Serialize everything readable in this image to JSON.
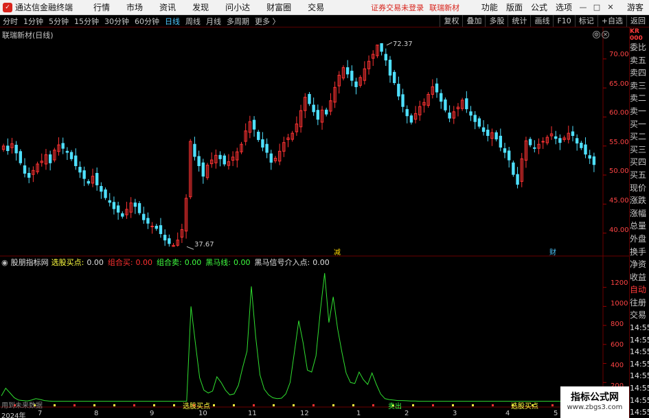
{
  "titlebar": {
    "app_title": "通达信金融终端",
    "menu": [
      "行情",
      "市场",
      "资讯",
      "发现",
      "问小达",
      "财富圈",
      "交易"
    ],
    "alert": "证券交易未登录",
    "stock": "联瑞新材",
    "right_menu": [
      "功能",
      "版面",
      "公式",
      "选项"
    ],
    "guest": "游客"
  },
  "toolbar": {
    "periods": [
      "分时",
      "1分钟",
      "5分钟",
      "15分钟",
      "30分钟",
      "60分钟",
      "日线",
      "周线",
      "月线",
      "多周期",
      "更多 〉"
    ],
    "active_period": "日线",
    "right_buttons": [
      "复权",
      "叠加",
      "多股",
      "统计",
      "画线",
      "F10",
      "标记",
      "+自选",
      "返回"
    ]
  },
  "chart": {
    "title": "联瑞新材(日线)",
    "high_label": "72.37",
    "low_label": "37.67",
    "marker_jian": "减",
    "marker_cai": "财",
    "price_ticks": [
      "70.00",
      "65.00",
      "60.00",
      "55.00",
      "50.00",
      "45.00",
      "40.00"
    ]
  },
  "indicator": {
    "name": "股朋指标网",
    "items": [
      {
        "label": "选股买点:",
        "value": "0.00",
        "color": "#ffff40"
      },
      {
        "label": "组合买:",
        "value": "0.00",
        "color": "#ff3030"
      },
      {
        "label": "组合卖:",
        "value": "0.00",
        "color": "#40ff40"
      },
      {
        "label": "黑马线:",
        "value": "0.00",
        "color": "#40ff40"
      },
      {
        "label": "黑马信号介入点:",
        "value": "0.00",
        "color": "#e0e0e0"
      }
    ],
    "ticks": [
      "1200",
      "1000",
      "800",
      "600",
      "400",
      "200"
    ],
    "buy_point_label": "选股买点",
    "sell_label": "卖出",
    "no_data": "用到未来数据"
  },
  "x_axis": {
    "year_label": "2024年",
    "months": [
      "7",
      "8",
      "9",
      "10",
      "11",
      "12",
      "1",
      "2",
      "3",
      "4",
      "5"
    ]
  },
  "sidepanel": {
    "header": "KR\n000",
    "items": [
      "委比",
      "卖五",
      "卖四",
      "卖三",
      "卖二",
      "卖一",
      "买一",
      "买二",
      "买三",
      "买四",
      "买五",
      "现价",
      "涨跌",
      "涨幅",
      "总量",
      "外盘",
      "换手",
      "净资",
      "收益",
      "自动",
      "往册",
      "交易"
    ],
    "times": [
      "14:55",
      "14:55",
      "14:55",
      "14:55",
      "14:55",
      "14:55",
      "14:55",
      "14:55"
    ]
  },
  "watermark": {
    "title": "指标公式网",
    "url": "www.zbgs3.com"
  },
  "colors": {
    "up": "#ff3333",
    "down": "#4fe0ff",
    "indicator_line": "#30e030",
    "accent_red": "#d8241c"
  },
  "chart_data": {
    "type": "candlestick",
    "title": "联瑞新材(日线)",
    "ylim": [
      37,
      74
    ],
    "y_ticks": [
      40,
      45,
      50,
      55,
      60,
      65,
      70
    ],
    "highest": 72.37,
    "lowest": 37.67,
    "close_path": [
      55,
      54.2,
      55.4,
      53.8,
      52.1,
      50.3,
      49.6,
      50.8,
      51.9,
      52.4,
      53.5,
      52.1,
      54.3,
      55.2,
      54.6,
      53.9,
      52.8,
      51.6,
      50.5,
      49.4,
      48.6,
      49.8,
      48.3,
      47.2,
      46.1,
      45.3,
      44.2,
      43.6,
      42.9,
      44.1,
      45.2,
      44.6,
      43.5,
      42.3,
      41.7,
      41.2,
      40.8,
      39.9,
      38.8,
      38.2,
      37.9,
      38.8,
      40.6,
      46.0,
      55.8,
      53.2,
      51.6,
      49.8,
      51.7,
      52.6,
      53.4,
      52.8,
      51.9,
      52.3,
      53.1,
      54.0,
      55.3,
      57.6,
      59.2,
      57.9,
      56.1,
      54.8,
      53.9,
      52.2,
      52.9,
      54.1,
      55.6,
      56.4,
      57.2,
      58.8,
      61.1,
      63.4,
      62.3,
      60.9,
      59.6,
      61.2,
      60.5,
      62.8,
      65.1,
      67.2,
      68.5,
      67.4,
      66.3,
      65.2,
      66.8,
      68.3,
      69.6,
      70.8,
      72.4,
      71.3,
      69.8,
      67.2,
      65.9,
      63.6,
      61.8,
      60.2,
      59.1,
      60.6,
      61.8,
      62.5,
      63.9,
      65.2,
      64.3,
      62.7,
      61.2,
      59.8,
      60.9,
      61.7,
      62.9,
      61.4,
      60.3,
      59.2,
      58.4,
      57.5,
      56.8,
      57.3,
      56.2,
      54.8,
      53.9,
      52.6,
      50.1,
      48.4,
      52.8,
      55.9,
      55.2,
      54.6,
      55.3,
      55.8,
      56.5,
      57.1,
      56.3,
      55.6,
      56.4,
      57.2,
      56.8,
      55.5,
      54.7,
      53.6,
      52.9,
      51.8
    ],
    "indicator_series": {
      "name": "黑马线",
      "ylim": [
        0,
        1450
      ],
      "y_ticks": [
        200,
        400,
        600,
        800,
        1000,
        1200
      ],
      "values": [
        60,
        140,
        90,
        40,
        15,
        10,
        5,
        15,
        30,
        22,
        10,
        5,
        3,
        3,
        3,
        3,
        3,
        3,
        3,
        3,
        3,
        3,
        3,
        3,
        3,
        3,
        3,
        3,
        3,
        3,
        3,
        3,
        3,
        3,
        3,
        3,
        3,
        3,
        3,
        3,
        3,
        3,
        3,
        3,
        1000,
        620,
        250,
        120,
        90,
        110,
        260,
        200,
        120,
        70,
        80,
        170,
        360,
        530,
        1210,
        690,
        280,
        130,
        70,
        40,
        30,
        35,
        80,
        200,
        520,
        850,
        620,
        330,
        310,
        480,
        950,
        1350,
        830,
        1100,
        770,
        520,
        300,
        200,
        190,
        310,
        230,
        180,
        300,
        180,
        80,
        30,
        20,
        15,
        10,
        10,
        8,
        6,
        5,
        3,
        3,
        3,
        3,
        3,
        3,
        3,
        3,
        3,
        3,
        3,
        3,
        3,
        3,
        3,
        3,
        3,
        3,
        3,
        3,
        3,
        3,
        3,
        3,
        3,
        3,
        3,
        3,
        3,
        3,
        3,
        3,
        3,
        3,
        3,
        3,
        3,
        3,
        3,
        3,
        3,
        3
      ]
    }
  }
}
